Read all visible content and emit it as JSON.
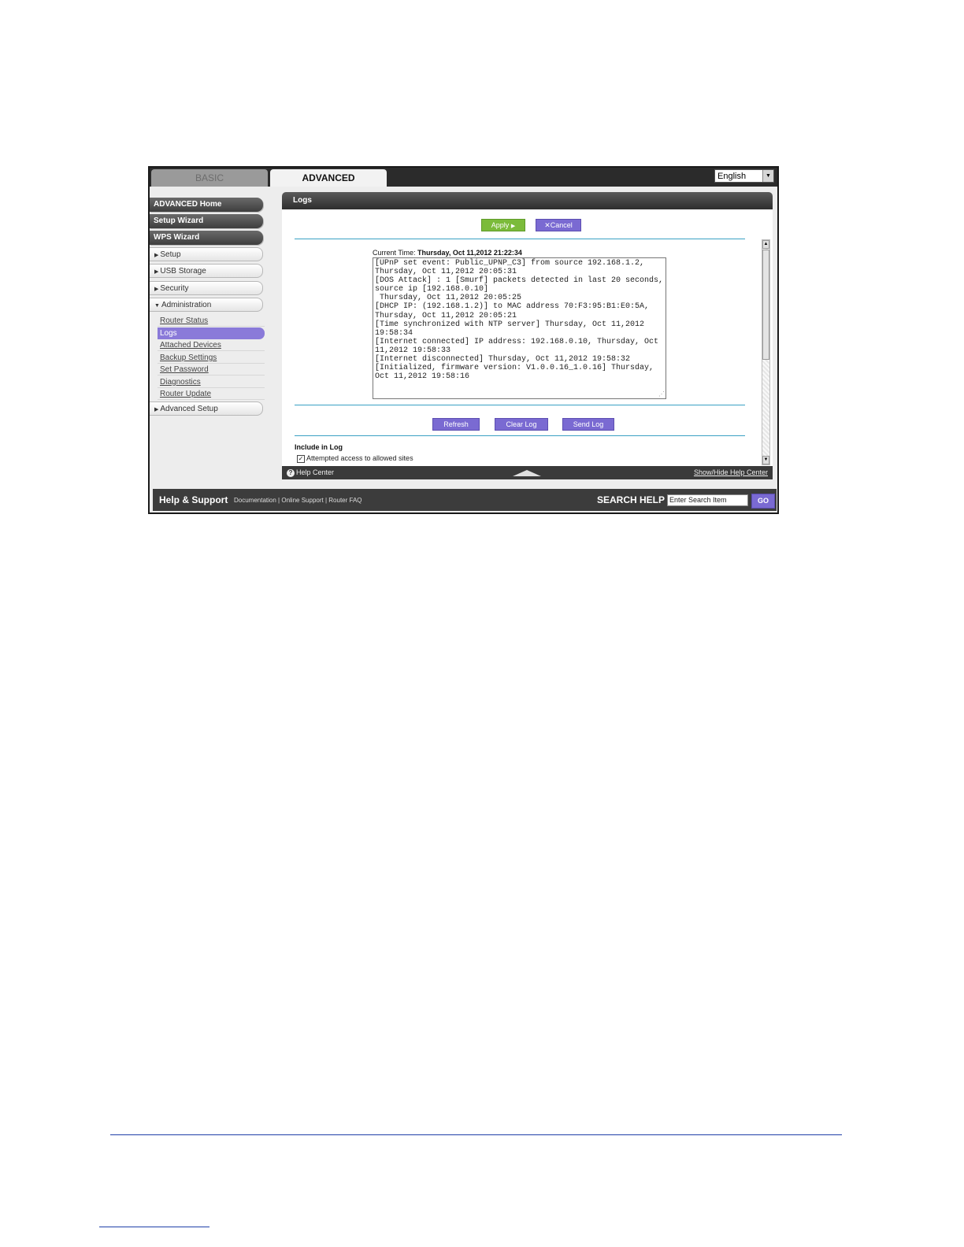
{
  "tabs": {
    "basic": "BASIC",
    "advanced": "ADVANCED"
  },
  "language": {
    "selected": "English"
  },
  "sidebar": {
    "advanced_home": "ADVANCED Home",
    "setup_wizard": "Setup Wizard",
    "wps_wizard": "WPS Wizard",
    "setup": "Setup",
    "usb_storage": "USB Storage",
    "security": "Security",
    "administration": "Administration",
    "admin_items": [
      "Router Status",
      "Logs",
      "Attached Devices",
      "Backup Settings",
      "Set Password",
      "Diagnostics",
      "Router Update"
    ],
    "advanced_setup": "Advanced Setup"
  },
  "panel": {
    "title": "Logs",
    "apply": "Apply",
    "cancel": "Cancel",
    "current_time_label": "Current Time:",
    "current_time_value": "Thursday, Oct 11,2012 21:22:34",
    "log_lines": [
      "[UPnP set event: Public_UPNP_C3] from source 192.168.1.2,",
      "Thursday, Oct 11,2012 20:05:31",
      "[DOS Attack] : 1 [Smurf] packets detected in last 20 seconds,",
      "source ip [192.168.0.10]",
      " Thursday, Oct 11,2012 20:05:25",
      "[DHCP IP: (192.168.1.2)] to MAC address 70:F3:95:B1:E0:5A,",
      "Thursday, Oct 11,2012 20:05:21",
      "[Time synchronized with NTP server] Thursday, Oct 11,2012",
      "19:58:34",
      "[Internet connected] IP address: 192.168.0.10, Thursday, Oct",
      "11,2012 19:58:33",
      "[Internet disconnected] Thursday, Oct 11,2012 19:58:32",
      "[Initialized, firmware version: V1.0.0.16_1.0.16] Thursday,",
      "Oct 11,2012 19:58:16"
    ],
    "refresh": "Refresh",
    "clear_log": "Clear Log",
    "send_log": "Send Log",
    "include_title": "Include in Log",
    "include_item": "Attempted access to allowed sites"
  },
  "help_bar": {
    "help_center": "Help Center",
    "toggle": "Show/Hide Help Center"
  },
  "footer": {
    "title": "Help & Support",
    "links": [
      "Documentation",
      "Online Support",
      "Router FAQ"
    ],
    "search_label": "SEARCH HELP",
    "search_value": "Enter Search Item",
    "go": "GO"
  },
  "colors": {
    "accent_purple": "#7a6ad2",
    "apply_green": "#7bbb3a",
    "divider_blue": "#3aa1c4"
  }
}
